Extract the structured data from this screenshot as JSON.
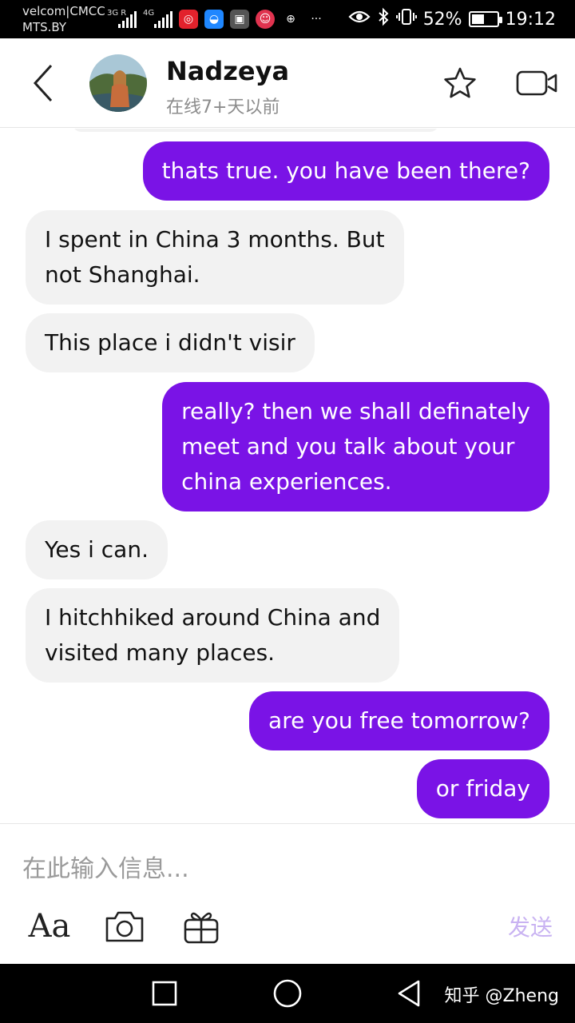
{
  "status_bar": {
    "carrier_line1": "velcom|CMCC",
    "carrier_line2": "MTS.BY",
    "sig1_tag": "3G R",
    "sig2_tag": "4G",
    "battery_percent": "52%",
    "battery_level": 0.52,
    "time": "19:12",
    "icons": [
      "signal-icon",
      "signal-icon",
      "app-icon",
      "app-icon",
      "app-icon",
      "app-icon",
      "app-icon",
      "more-icon",
      "eye-icon",
      "bluetooth-icon",
      "vibrate-icon",
      "battery-icon"
    ]
  },
  "header": {
    "contact_name": "Nadzeya",
    "contact_status": "在线7+天以前",
    "back_icon": "chevron-left-icon",
    "star_icon": "star-icon",
    "video_icon": "video-camera-icon"
  },
  "messages": [
    {
      "direction": "out",
      "text": "thats true. you have been there?"
    },
    {
      "direction": "in",
      "text": "I spent in China 3 months. But\nnot Shanghai."
    },
    {
      "direction": "in",
      "text": "This place i didn't visir"
    },
    {
      "direction": "out",
      "text": "really? then we shall definately\nmeet and you talk about your\nchina experiences."
    },
    {
      "direction": "in",
      "text": "Yes i can."
    },
    {
      "direction": "in",
      "text": "I hitchhiked around China and\nvisited many places."
    },
    {
      "direction": "out",
      "text": "are you free tomorrow?"
    },
    {
      "direction": "out",
      "text": "or friday"
    }
  ],
  "composer": {
    "placeholder": "在此输入信息...",
    "font_tool_label": "Aa",
    "send_label": "发送",
    "camera_icon": "camera-icon",
    "gift_icon": "gift-icon"
  },
  "nav": {
    "watermark": "知乎 @Zheng"
  },
  "colors": {
    "outgoing_bubble": "#7a13e6",
    "incoming_bubble": "#f2f2f2",
    "send_disabled": "#c9b3f2"
  }
}
